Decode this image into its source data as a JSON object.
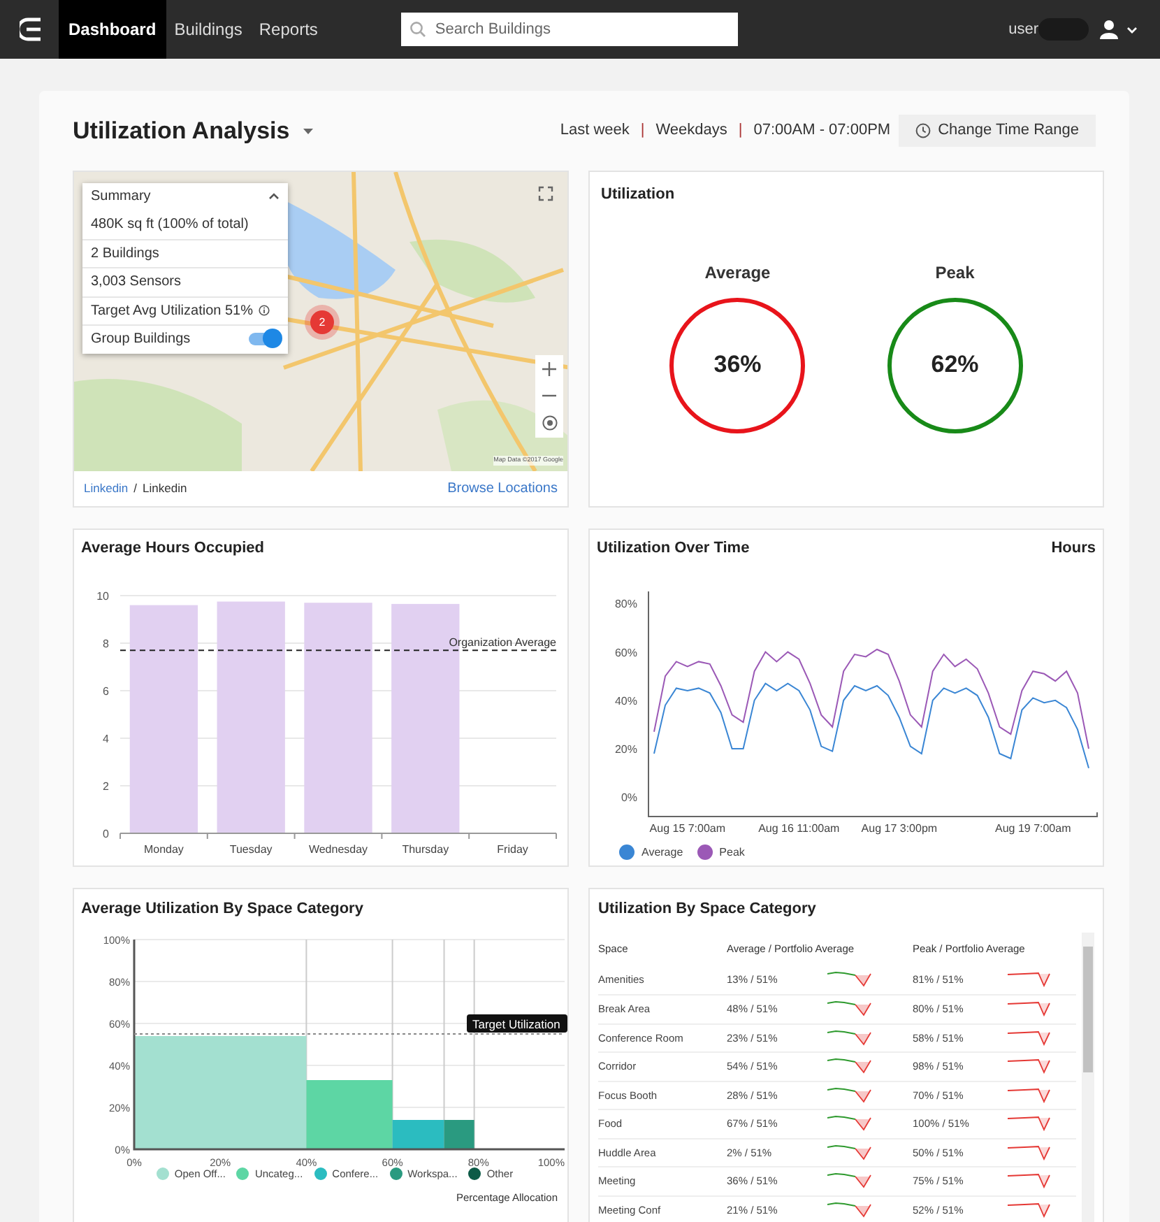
{
  "navbar": {
    "tabs": [
      {
        "label": "Dashboard",
        "selected": true
      },
      {
        "label": "Buildings",
        "selected": false
      },
      {
        "label": "Reports",
        "selected": false
      }
    ],
    "search": {
      "placeholder": "Search Buildings"
    },
    "user": "user"
  },
  "header": {
    "title": "Utilization Analysis",
    "filters": [
      "Last week",
      "Weekdays",
      "07:00AM - 07:00PM"
    ],
    "separator": "|",
    "button": "Change Time Range"
  },
  "map_card": {
    "summary": {
      "title": "Summary",
      "expanded": true,
      "items": [
        {
          "kind": "text",
          "label": "480K sq ft (100% of total)"
        },
        {
          "kind": "text",
          "label": "2 Buildings"
        },
        {
          "kind": "text",
          "label": "3,003 Sensors"
        },
        {
          "kind": "info",
          "label": "Target Avg Utilization 51%"
        },
        {
          "kind": "toggle",
          "label": "Group Buildings",
          "on": true
        }
      ]
    },
    "cluster_count": "2",
    "attribution": "Map Data ©2017 Google",
    "breadcrumb": [
      "Linkedin",
      "Linkedin"
    ],
    "breadcrumb_separator": "/",
    "link": "Browse Locations"
  },
  "utilization": {
    "title": "Utilization",
    "gauges": [
      {
        "label": "Average",
        "value": "36%",
        "color": "#e8141b"
      },
      {
        "label": "Peak",
        "value": "62%",
        "color": "#188a18"
      }
    ]
  },
  "hours_chart": {
    "title": "Average Hours Occupied",
    "chart_data": {
      "type": "bar",
      "categories": [
        "Monday",
        "Tuesday",
        "Wednesday",
        "Thursday",
        "Friday"
      ],
      "values": [
        9.6,
        9.75,
        9.7,
        9.65,
        null
      ],
      "ylim": [
        0,
        10
      ],
      "yticks": [
        0,
        2,
        4,
        6,
        8,
        10
      ],
      "grid": true,
      "ref_lines": [
        {
          "axis": "y",
          "value": 7.7,
          "label": "Organization Average"
        }
      ]
    }
  },
  "time_chart": {
    "title": "Utilization Over Time",
    "side_label": "Hours",
    "chart_data": {
      "type": "line",
      "categories": [
        null,
        null,
        null,
        "Aug 15 7:00am",
        null,
        null,
        null,
        null,
        null,
        null,
        null,
        null,
        null,
        "Aug 16 11:00am",
        null,
        null,
        null,
        null,
        null,
        null,
        null,
        null,
        "Aug 17 3:00pm",
        null,
        null,
        null,
        null,
        null,
        null,
        null,
        null,
        null,
        null,
        null,
        "Aug 19 7:00am",
        null,
        null,
        null,
        null,
        null
      ],
      "series": [
        {
          "name": "Average",
          "color": "#3a86d4",
          "values": [
            18,
            38,
            45,
            44,
            45,
            43,
            35,
            20,
            20,
            40,
            47,
            44,
            47,
            44,
            36,
            21,
            19,
            40,
            46,
            44,
            46,
            42,
            33,
            21,
            18,
            40,
            45,
            43,
            45,
            42,
            33,
            18,
            16,
            36,
            41,
            39,
            40,
            37,
            28,
            12
          ]
        },
        {
          "name": "Peak",
          "color": "#9b59b6",
          "values": [
            27,
            50,
            56,
            54,
            56,
            55,
            46,
            34,
            31,
            52,
            60,
            56,
            60,
            57,
            47,
            34,
            29,
            52,
            59,
            58,
            61,
            59,
            48,
            34,
            29,
            52,
            59,
            54,
            57,
            53,
            43,
            29,
            26,
            44,
            52,
            51,
            48,
            52,
            43,
            20
          ]
        }
      ],
      "ylim": [
        -8,
        85
      ],
      "yticks": [
        {
          "value": 0,
          "label": "0%"
        },
        {
          "value": 20,
          "label": "20%"
        },
        {
          "value": 40,
          "label": "40%"
        },
        {
          "value": 60,
          "label": "60%"
        },
        {
          "value": 80,
          "label": "80%"
        }
      ]
    }
  },
  "category_chart": {
    "title": "Average Utilization By Space Category",
    "chart_data": {
      "type": "bar",
      "xlabel": "Percentage Allocation",
      "x": [
        20,
        50,
        66,
        75.5
      ],
      "series": [
        {
          "name": "Open Off...",
          "color": "#a3e0d0",
          "values": [
            54,
            null,
            null,
            null
          ]
        },
        {
          "name": "Uncateg...",
          "color": "#5dd6a4",
          "values": [
            null,
            33,
            null,
            null
          ]
        },
        {
          "name": "Confere...",
          "color": "#2bbcc0",
          "values": [
            null,
            null,
            14,
            null
          ]
        },
        {
          "name": "Workspa...",
          "color": "#2a9a80",
          "values": [
            null,
            null,
            null,
            14
          ]
        },
        {
          "name": "Other",
          "color": "#0d5b47",
          "values": [
            null,
            null,
            null,
            null
          ]
        }
      ],
      "grid": true,
      "xlim": [
        0,
        100
      ],
      "ylim": [
        0,
        100
      ],
      "xticks": [
        {
          "value": 0,
          "label": "0%"
        },
        {
          "value": 20,
          "label": "20%"
        },
        {
          "value": 40,
          "label": "40%"
        },
        {
          "value": 60,
          "label": "60%"
        },
        {
          "value": 80,
          "label": "80%"
        },
        {
          "value": 100,
          "label": "100%"
        }
      ],
      "yticks": [
        {
          "value": 0,
          "label": "0%"
        },
        {
          "value": 20,
          "label": "20%"
        },
        {
          "value": 40,
          "label": "40%"
        },
        {
          "value": 60,
          "label": "60%"
        },
        {
          "value": 80,
          "label": "80%"
        },
        {
          "value": 100,
          "label": "100%"
        }
      ],
      "ref_lines": [
        {
          "axis": "y",
          "value": 55,
          "label": "Target Utilization"
        }
      ]
    }
  },
  "space_table": {
    "title": "Utilization By Space Category",
    "columns": [
      "Space",
      "Average / Portfolio Average",
      "Peak / Portfolio Average"
    ],
    "rows": [
      {
        "space": "Amenities",
        "average": "13% / 51%",
        "peak": "81% / 51%"
      },
      {
        "space": "Break Area",
        "average": "48% / 51%",
        "peak": "80% / 51%"
      },
      {
        "space": "Conference Room",
        "average": "23% / 51%",
        "peak": "58% / 51%"
      },
      {
        "space": "Corridor",
        "average": "54% / 51%",
        "peak": "98% / 51%"
      },
      {
        "space": "Focus Booth",
        "average": "28% / 51%",
        "peak": "70% / 51%"
      },
      {
        "space": "Food",
        "average": "67% / 51%",
        "peak": "100% / 51%"
      },
      {
        "space": "Huddle Area",
        "average": "2% / 51%",
        "peak": "50% / 51%"
      },
      {
        "space": "Meeting",
        "average": "36% / 51%",
        "peak": "75% / 51%"
      },
      {
        "space": "Meeting Conf",
        "average": "21% / 51%",
        "peak": "52% / 51%"
      }
    ]
  }
}
